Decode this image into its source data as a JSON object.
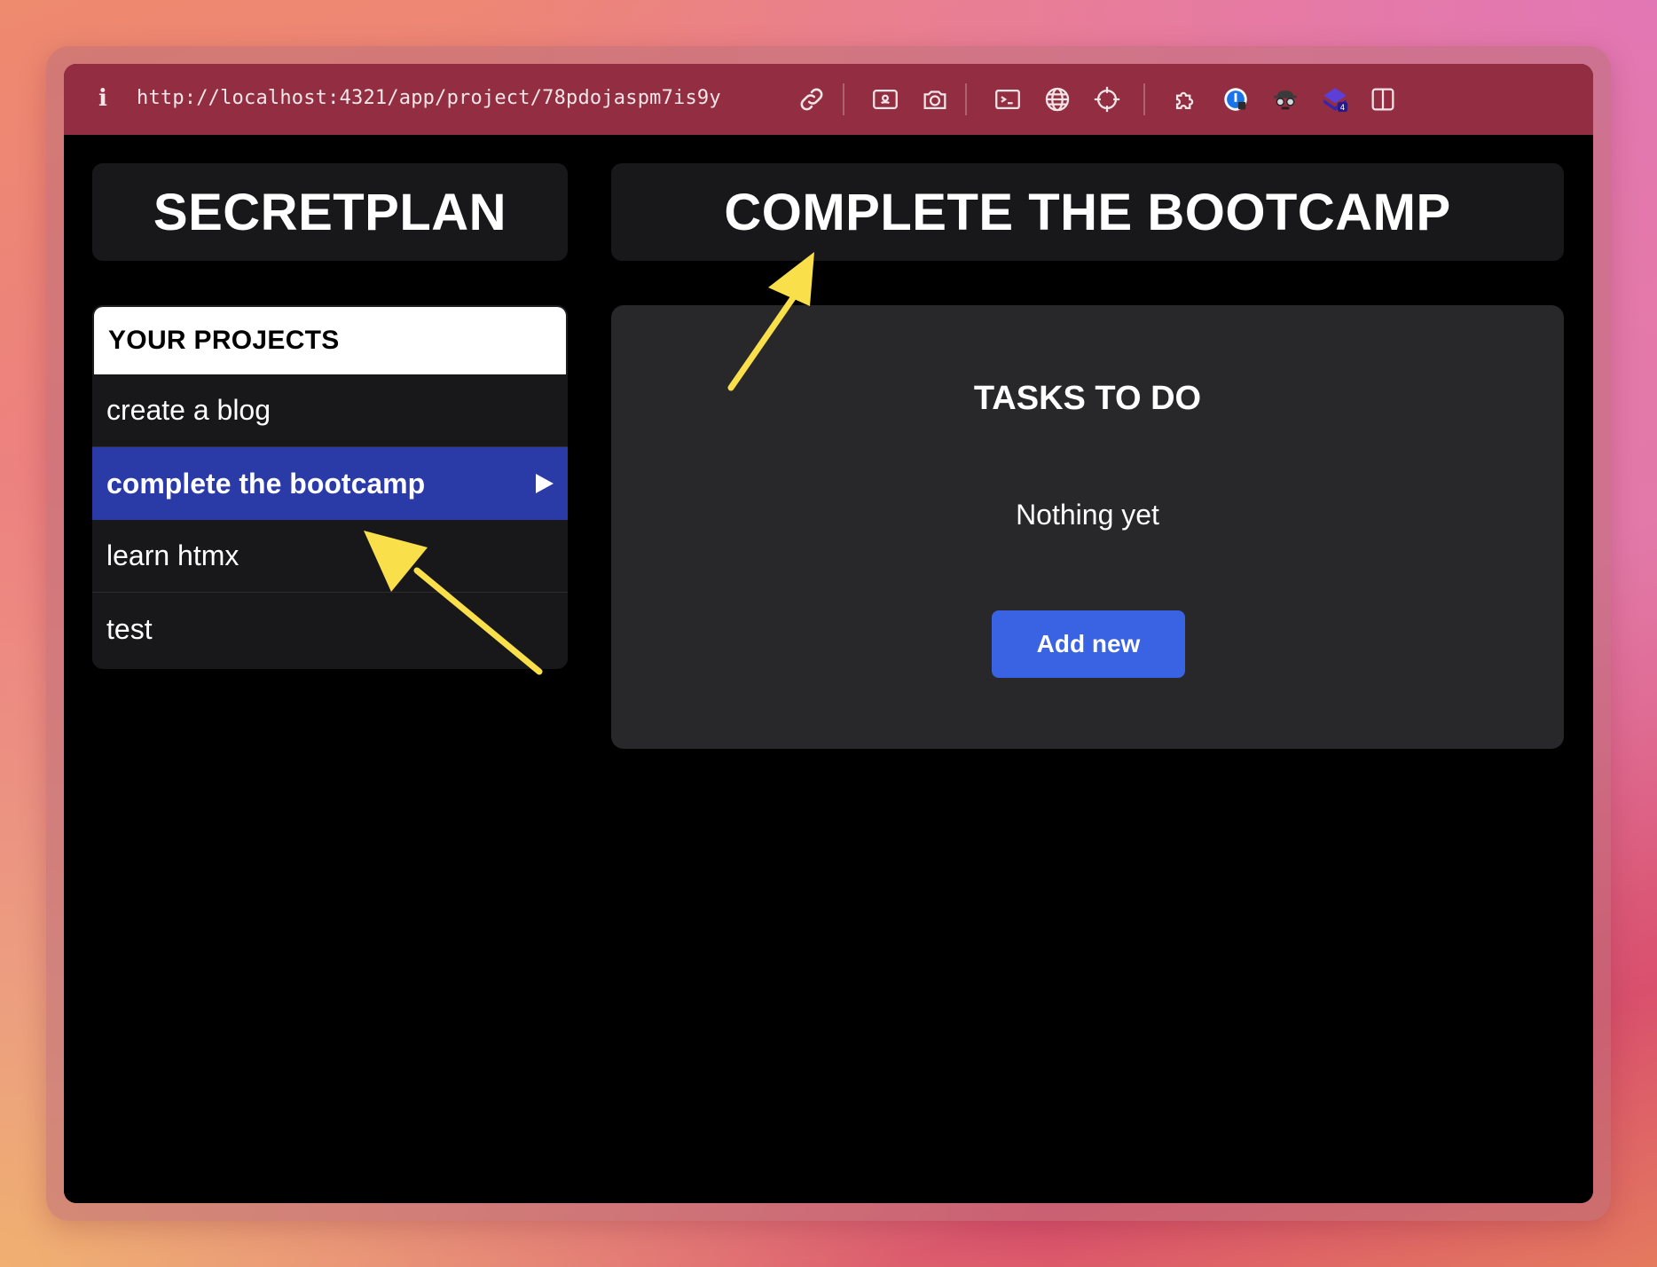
{
  "browser": {
    "url": "http://localhost:4321/app/project/78pdojaspm7is9y",
    "info_icon": "i"
  },
  "toolbar_icons": [
    "link-icon",
    "image-frame-icon",
    "camera-icon",
    "terminal-icon",
    "globe-icon",
    "crosshair-icon",
    "extensions-icon",
    "password-manager-icon",
    "spy-icon",
    "layers-badge-icon",
    "sidebar-toggle-icon"
  ],
  "toolbar_badge": "4",
  "app": {
    "logo": "SECRETPLAN",
    "project_title": "COMPLETE THE BOOTCAMP"
  },
  "projects": {
    "header": "YOUR PROJECTS",
    "items": [
      {
        "label": "create a blog",
        "active": false
      },
      {
        "label": "complete the bootcamp",
        "active": true
      },
      {
        "label": "learn htmx",
        "active": false
      },
      {
        "label": "test",
        "active": false
      }
    ]
  },
  "tasks": {
    "title": "TASKS TO DO",
    "empty_text": "Nothing yet",
    "add_label": "Add new"
  },
  "colors": {
    "toolbar": "#932e42",
    "active_item": "#2a3ba8",
    "add_button": "#3a63e3",
    "annotation_arrow": "#f9e04b"
  }
}
